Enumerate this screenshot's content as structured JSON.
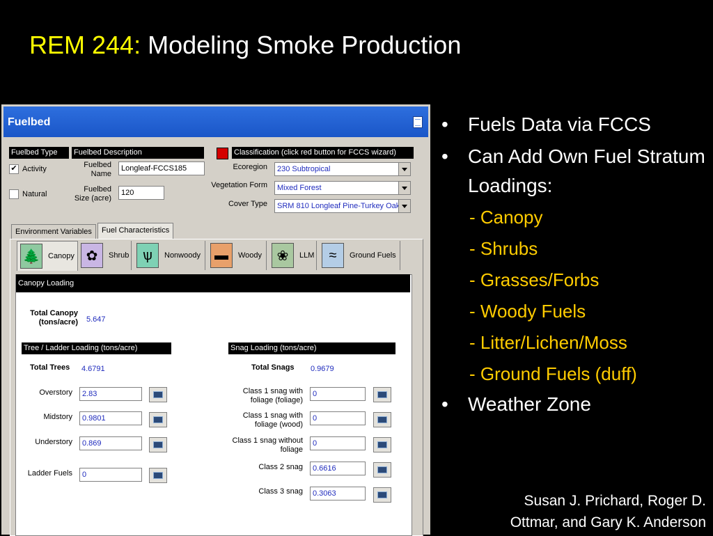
{
  "slide": {
    "title_course": "REM 244:",
    "title_topic": "Modeling Smoke Production",
    "bullets": [
      "Fuels Data via FCCS",
      "Can Add Own Fuel Stratum Loadings:",
      "Weather Zone"
    ],
    "subitems": [
      "- Canopy",
      "- Shrubs",
      "- Grasses/Forbs",
      "- Woody Fuels",
      "- Litter/Lichen/Moss",
      "- Ground Fuels (duff)"
    ],
    "credits_line1": "Susan J. Prichard, Roger D.",
    "credits_line2": "Ottmar, and Gary K. Anderson",
    "colors": {
      "title_accent": "#ffff00",
      "subitem": "#ffcc00",
      "background": "#000000"
    }
  },
  "window": {
    "title": "Fuelbed",
    "fuelbed_type_header": "Fuelbed Type",
    "fuelbed_description_header": "Fuelbed Description",
    "classification_header": "Classification (click red button for FCCS wizard)",
    "activity_label": "Activity",
    "activity_checked": "✔",
    "natural_label": "Natural",
    "fuelbed_name_label": "Fuelbed Name",
    "fuelbed_name_value": "Longleaf-FCCS185",
    "fuelbed_size_label": "Fuelbed Size (acre)",
    "fuelbed_size_value": "120",
    "ecoregion_label": "Ecoregion",
    "ecoregion_value": "230 Subtropical",
    "vegetation_form_label": "Vegetation Form",
    "vegetation_form_value": "Mixed Forest",
    "cover_type_label": "Cover Type",
    "cover_type_value": "SRM 810 Longleaf Pine-Turkey Oak",
    "tabs": [
      "Environment Variables",
      "Fuel Characteristics"
    ],
    "fuel_tabs": [
      "Canopy",
      "Shrub",
      "Nonwoody",
      "Woody",
      "LLM",
      "Ground Fuels"
    ],
    "canopy_loading_header": "Canopy Loading",
    "total_canopy_label": "Total Canopy (tons/acre)",
    "total_canopy_value": "5.647",
    "tree_header": "Tree / Ladder Loading (tons/acre)",
    "snag_header": "Snag Loading (tons/acre)",
    "total_trees_label": "Total Trees",
    "total_trees_value": "4.6791",
    "total_snags_label": "Total Snags",
    "total_snags_value": "0.9679",
    "trees": [
      {
        "label": "Overstory",
        "value": "2.83"
      },
      {
        "label": "Midstory",
        "value": "0.9801"
      },
      {
        "label": "Understory",
        "value": "0.869"
      },
      {
        "label": "Ladder Fuels",
        "value": "0"
      }
    ],
    "snags": [
      {
        "label": "Class 1 snag with foliage (foliage)",
        "value": "0"
      },
      {
        "label": "Class 1 snag with foliage (wood)",
        "value": "0"
      },
      {
        "label": "Class 1 snag without foliage",
        "value": "0"
      },
      {
        "label": "Class 2 snag",
        "value": "0.6616"
      },
      {
        "label": "Class 3 snag",
        "value": "0.3063"
      }
    ]
  }
}
